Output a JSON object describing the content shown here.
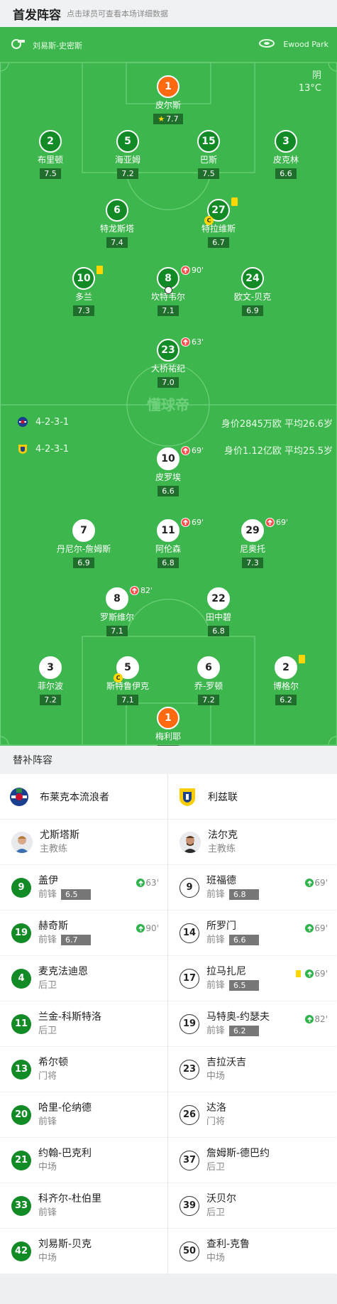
{
  "header": {
    "title": "首发阵容",
    "subtitle": "点击球员可查看本场详细数据"
  },
  "match": {
    "referee": "刘易斯-史密斯",
    "venue": "Ewood Park",
    "weather": "阴",
    "temperature": "13°C",
    "watermark": "懂球帝"
  },
  "home": {
    "name": "布莱克本流浪者",
    "formation": "4-2-3-1",
    "value_text": "身价2845万欧 平均26.6岁",
    "players": [
      {
        "num": "1",
        "name": "皮尔斯",
        "rating": "7.7",
        "gk": true,
        "star": true
      },
      {
        "num": "2",
        "name": "布里顿",
        "rating": "7.5"
      },
      {
        "num": "5",
        "name": "海亚姆",
        "rating": "7.2"
      },
      {
        "num": "15",
        "name": "巴斯",
        "rating": "7.5"
      },
      {
        "num": "3",
        "name": "皮克林",
        "rating": "6.6"
      },
      {
        "num": "6",
        "name": "特龙斯塔",
        "rating": "7.4"
      },
      {
        "num": "27",
        "name": "特拉维斯",
        "rating": "6.7",
        "captain": true,
        "yellow": true
      },
      {
        "num": "10",
        "name": "多兰",
        "rating": "7.3",
        "yellow": true
      },
      {
        "num": "8",
        "name": "坎特韦尔",
        "rating": "7.1",
        "sub": "90'",
        "goal": true
      },
      {
        "num": "24",
        "name": "欧文-贝克",
        "rating": "6.9"
      },
      {
        "num": "23",
        "name": "大桥祐纪",
        "rating": "7.0",
        "sub": "63'"
      }
    ]
  },
  "away": {
    "name": "利兹联",
    "formation": "4-2-3-1",
    "value_text": "身价1.12亿欧 平均25.5岁",
    "players": [
      {
        "num": "10",
        "name": "皮罗埃",
        "rating": "6.6",
        "sub": "69'"
      },
      {
        "num": "7",
        "name": "丹尼尔-詹姆斯",
        "rating": "6.9"
      },
      {
        "num": "11",
        "name": "阿伦森",
        "rating": "6.8",
        "sub": "69'"
      },
      {
        "num": "29",
        "name": "尼奥托",
        "rating": "7.3",
        "sub": "69'"
      },
      {
        "num": "8",
        "name": "罗斯维尔",
        "rating": "7.1",
        "sub": "82'"
      },
      {
        "num": "22",
        "name": "田中碧",
        "rating": "6.8"
      },
      {
        "num": "3",
        "name": "菲尔波",
        "rating": "7.2"
      },
      {
        "num": "5",
        "name": "斯特鲁伊克",
        "rating": "7.1",
        "captain": true
      },
      {
        "num": "6",
        "name": "乔-罗顿",
        "rating": "7.2"
      },
      {
        "num": "2",
        "name": "博格尔",
        "rating": "6.2",
        "yellow": true
      },
      {
        "num": "1",
        "name": "梅利耶",
        "rating": "6.8",
        "gk": true
      }
    ]
  },
  "subs": {
    "title": "替补阵容",
    "home": {
      "team": "布莱克本流浪者",
      "coach": {
        "name": "尤斯塔斯",
        "role": "主教练"
      },
      "players": [
        {
          "num": "9",
          "name": "盖伊",
          "pos": "前锋",
          "rating": "6.5",
          "in": "63'"
        },
        {
          "num": "19",
          "name": "赫奇斯",
          "pos": "前锋",
          "rating": "6.7",
          "in": "90'"
        },
        {
          "num": "4",
          "name": "麦克法迪恩",
          "pos": "后卫"
        },
        {
          "num": "11",
          "name": "兰金-科斯特洛",
          "pos": "后卫"
        },
        {
          "num": "13",
          "name": "希尔顿",
          "pos": "门将"
        },
        {
          "num": "20",
          "name": "哈里-伦纳德",
          "pos": "前锋"
        },
        {
          "num": "21",
          "name": "约翰-巴克利",
          "pos": "中场"
        },
        {
          "num": "33",
          "name": "科齐尔-杜伯里",
          "pos": "前锋"
        },
        {
          "num": "42",
          "name": "刘易斯-贝克",
          "pos": "中场"
        }
      ]
    },
    "away": {
      "team": "利兹联",
      "coach": {
        "name": "法尔克",
        "role": "主教练"
      },
      "players": [
        {
          "num": "9",
          "name": "班福德",
          "pos": "前锋",
          "rating": "6.8",
          "in": "69'"
        },
        {
          "num": "14",
          "name": "所罗门",
          "pos": "前锋",
          "rating": "6.6",
          "in": "69'"
        },
        {
          "num": "17",
          "name": "拉马扎尼",
          "pos": "前锋",
          "rating": "6.5",
          "in": "69'",
          "yellow": true
        },
        {
          "num": "19",
          "name": "马特奥-约瑟夫",
          "pos": "前锋",
          "rating": "6.2",
          "in": "82'"
        },
        {
          "num": "23",
          "name": "吉拉沃吉",
          "pos": "中场"
        },
        {
          "num": "26",
          "name": "达洛",
          "pos": "门将"
        },
        {
          "num": "37",
          "name": "詹姆斯-德巴约",
          "pos": "后卫"
        },
        {
          "num": "39",
          "name": "沃贝尔",
          "pos": "后卫"
        },
        {
          "num": "50",
          "name": "查利-克鲁",
          "pos": "中场"
        }
      ]
    }
  }
}
